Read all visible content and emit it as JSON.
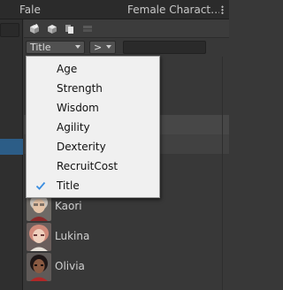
{
  "tabs": {
    "left": "Fale",
    "right": "Female Charact…"
  },
  "toolbar": {
    "buttons": [
      "cube-add-icon",
      "cube-icon",
      "duplicate-icon",
      "stack-icon"
    ]
  },
  "filter": {
    "field": "Title",
    "operator": ">"
  },
  "dropdown_menu": {
    "items": [
      {
        "label": "Age",
        "checked": false
      },
      {
        "label": "Strength",
        "checked": false
      },
      {
        "label": "Wisdom",
        "checked": false
      },
      {
        "label": "Agility",
        "checked": false
      },
      {
        "label": "Dexterity",
        "checked": false
      },
      {
        "label": "RecruitCost",
        "checked": false
      },
      {
        "label": "Title",
        "checked": true
      }
    ]
  },
  "characters": [
    {
      "name": "Kaori"
    },
    {
      "name": "Lukina"
    },
    {
      "name": "Olivia"
    }
  ],
  "colors": {
    "selection": "#2c5d87",
    "check": "#3a8de0",
    "menu_bg": "#f0f0f0"
  }
}
